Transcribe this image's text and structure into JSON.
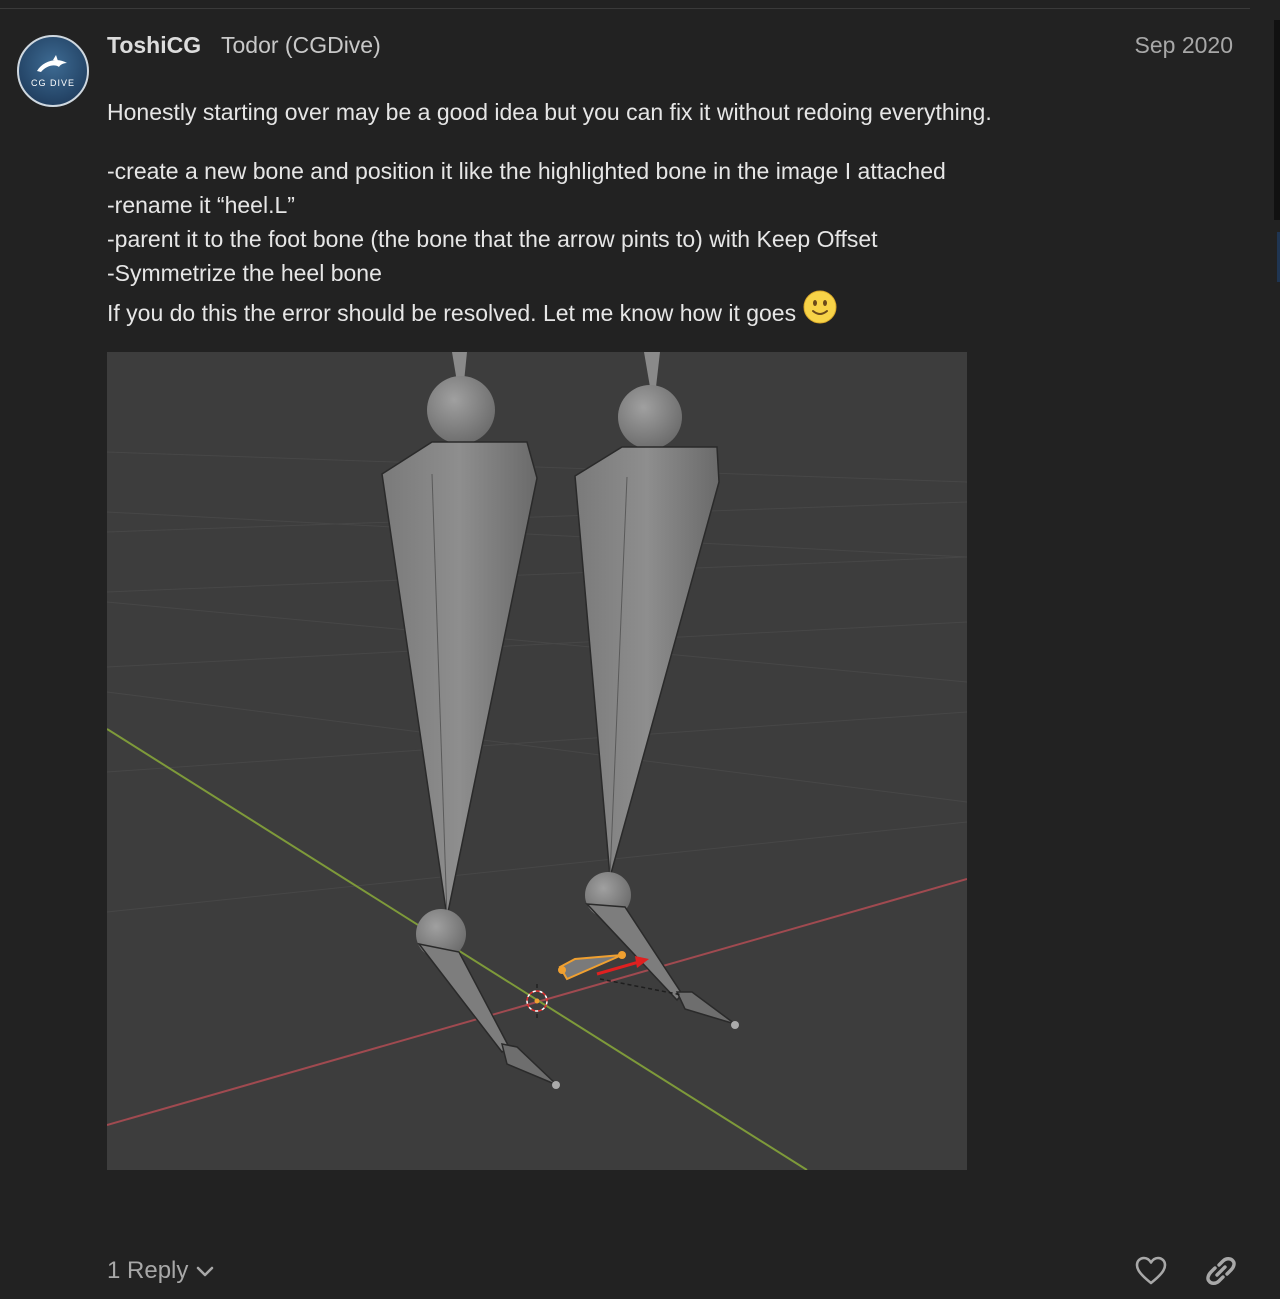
{
  "post": {
    "username": "ToshiCG",
    "full_name": "Todor (CGDive)",
    "date": "Sep 2020",
    "avatar": {
      "icon": "cgdive-logo",
      "text": "CG DIVE"
    },
    "intro": "Honestly starting over may be a good idea but you can fix it without redoing everything.",
    "steps": [
      "-create a new bone and position it like the highlighted bone in the image I attached",
      "-rename it “heel.L”",
      "-parent it to the foot bone (the bone that the arrow pints to) with Keep Offset",
      "-Symmetrize the heel bone"
    ],
    "closing": "If you do this the error should be resolved. Let me know how it goes",
    "closing_emoji": "slightly-smiling-face",
    "attachment": {
      "description_icon": "blender-viewport-screenshot",
      "colors": {
        "background": "#3d3d3d",
        "x_axis": "#a04a50",
        "y_axis": "#7e9a3a",
        "bone": "#8a8a8a",
        "selected_bone": "#f0a030",
        "arrow": "#e02020"
      }
    }
  },
  "footer": {
    "replies_label": "1 Reply",
    "like_icon": "heart-icon",
    "share_icon": "link-icon"
  }
}
